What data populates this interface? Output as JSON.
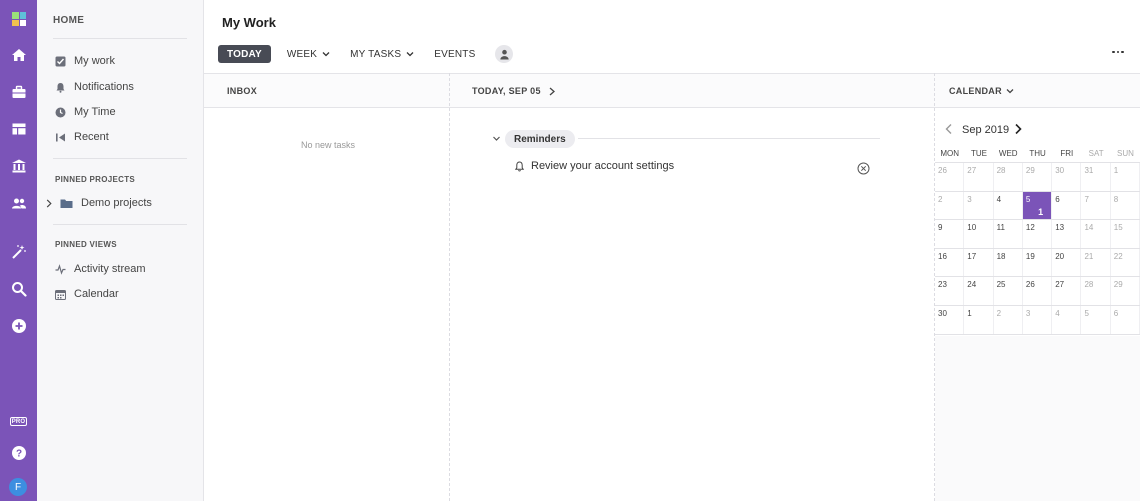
{
  "colors": {
    "rail": "#7b54b8",
    "today_cell": "#7b54b8",
    "active_tab": "#484b55"
  },
  "rail": {
    "icons": [
      "logo-icon",
      "home-icon",
      "briefcase-icon",
      "board-icon",
      "bank-icon",
      "people-icon",
      "magic-wand-icon",
      "search-icon",
      "plus-circle-icon",
      "help-icon"
    ],
    "pro_badge": "PRO",
    "avatar_initial": "F"
  },
  "sidebar": {
    "heading": "HOME",
    "items": [
      {
        "label": "My work",
        "icon": "checkbox-icon"
      },
      {
        "label": "Notifications",
        "icon": "bell-icon"
      },
      {
        "label": "My Time",
        "icon": "clock-icon"
      },
      {
        "label": "Recent",
        "icon": "recent-icon"
      }
    ],
    "pinned_projects_heading": "PINNED PROJECTS",
    "pinned_projects": [
      {
        "label": "Demo projects",
        "icon": "folder-icon"
      }
    ],
    "pinned_views_heading": "PINNED VIEWS",
    "pinned_views": [
      {
        "label": "Activity stream",
        "icon": "activity-icon"
      },
      {
        "label": "Calendar",
        "icon": "calendar-icon"
      }
    ]
  },
  "header": {
    "title": "My Work",
    "tabs": [
      {
        "label": "TODAY",
        "active": true
      },
      {
        "label": "WEEK",
        "dropdown": true
      },
      {
        "label": "MY TASKS",
        "dropdown": true
      },
      {
        "label": "EVENTS"
      }
    ]
  },
  "inbox": {
    "title": "INBOX",
    "empty_text": "No new tasks"
  },
  "today": {
    "title": "TODAY, SEP 05",
    "reminders_label": "Reminders",
    "reminders": [
      "Review your account settings"
    ]
  },
  "calendar": {
    "title": "CALENDAR",
    "month": "Sep 2019",
    "weekdays": [
      "MON",
      "TUE",
      "WED",
      "THU",
      "FRI",
      "SAT",
      "SUN"
    ],
    "weeks": [
      [
        {
          "d": "26",
          "m": true
        },
        {
          "d": "27",
          "m": true
        },
        {
          "d": "28",
          "m": true
        },
        {
          "d": "29",
          "m": true
        },
        {
          "d": "30",
          "m": true
        },
        {
          "d": "31",
          "m": true
        },
        {
          "d": "1",
          "m": true
        }
      ],
      [
        {
          "d": "2",
          "m": true
        },
        {
          "d": "3",
          "m": true
        },
        {
          "d": "4"
        },
        {
          "d": "5",
          "today": true,
          "count": "1"
        },
        {
          "d": "6"
        },
        {
          "d": "7",
          "m": true
        },
        {
          "d": "8",
          "m": true
        }
      ],
      [
        {
          "d": "9"
        },
        {
          "d": "10"
        },
        {
          "d": "11"
        },
        {
          "d": "12"
        },
        {
          "d": "13"
        },
        {
          "d": "14",
          "m": true
        },
        {
          "d": "15",
          "m": true
        }
      ],
      [
        {
          "d": "16"
        },
        {
          "d": "17"
        },
        {
          "d": "18"
        },
        {
          "d": "19"
        },
        {
          "d": "20"
        },
        {
          "d": "21",
          "m": true
        },
        {
          "d": "22",
          "m": true
        }
      ],
      [
        {
          "d": "23"
        },
        {
          "d": "24"
        },
        {
          "d": "25"
        },
        {
          "d": "26"
        },
        {
          "d": "27"
        },
        {
          "d": "28",
          "m": true
        },
        {
          "d": "29",
          "m": true
        }
      ],
      [
        {
          "d": "30"
        },
        {
          "d": "1"
        },
        {
          "d": "2",
          "m": true
        },
        {
          "d": "3",
          "m": true
        },
        {
          "d": "4",
          "m": true
        },
        {
          "d": "5",
          "m": true
        },
        {
          "d": "6",
          "m": true
        }
      ]
    ]
  }
}
